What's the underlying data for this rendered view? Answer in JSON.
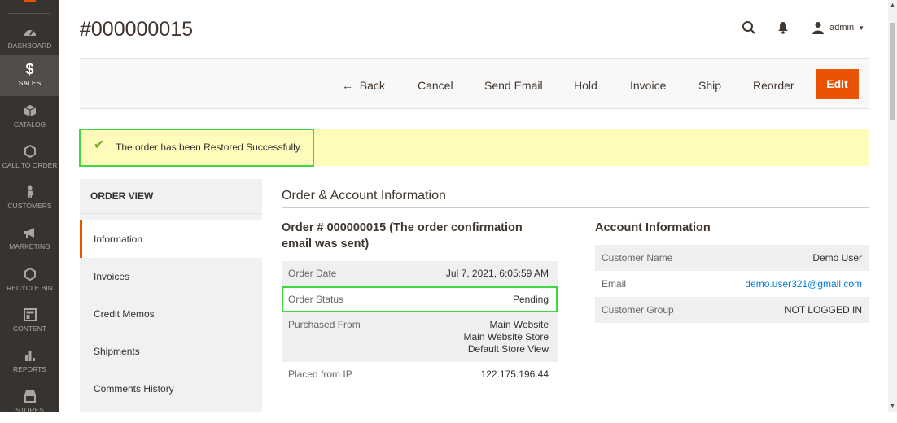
{
  "sidebar": {
    "items": [
      {
        "label": "DASHBOARD",
        "icon": "speedometer-icon"
      },
      {
        "label": "SALES",
        "icon": "dollar-icon"
      },
      {
        "label": "CATALOG",
        "icon": "box-icon"
      },
      {
        "label": "CALL TO ORDER",
        "icon": "hexagon-icon"
      },
      {
        "label": "CUSTOMERS",
        "icon": "person-icon"
      },
      {
        "label": "MARKETING",
        "icon": "megaphone-icon"
      },
      {
        "label": "RECYCLE BIN",
        "icon": "hexagon-icon"
      },
      {
        "label": "CONTENT",
        "icon": "layout-icon"
      },
      {
        "label": "REPORTS",
        "icon": "bar-chart-icon"
      },
      {
        "label": "STORES",
        "icon": "store-icon"
      }
    ]
  },
  "header": {
    "title": "#000000015",
    "user": "admin"
  },
  "actions": {
    "back": "Back",
    "cancel": "Cancel",
    "send_email": "Send Email",
    "hold": "Hold",
    "invoice": "Invoice",
    "ship": "Ship",
    "reorder": "Reorder",
    "edit": "Edit"
  },
  "message": "The order has been Restored Successfully.",
  "order_view": {
    "title": "ORDER VIEW",
    "tabs": [
      "Information",
      "Invoices",
      "Credit Memos",
      "Shipments",
      "Comments History"
    ]
  },
  "section_title": "Order & Account Information",
  "order": {
    "title_line1": "Order # 000000015 (The order confirmation",
    "title_line2": "email was sent)",
    "rows": [
      {
        "label": "Order Date",
        "value": "Jul 7, 2021, 6:05:59 AM"
      },
      {
        "label": "Order Status",
        "value": "Pending"
      },
      {
        "label": "Purchased From",
        "value_lines": [
          "Main Website",
          "Main Website Store",
          "Default Store View"
        ]
      },
      {
        "label": "Placed from IP",
        "value": "122.175.196.44"
      }
    ]
  },
  "account": {
    "title": "Account Information",
    "rows": [
      {
        "label": "Customer Name",
        "value": "Demo User"
      },
      {
        "label": "Email",
        "value": "demo.user321@gmail.com"
      },
      {
        "label": "Customer Group",
        "value": "NOT LOGGED IN"
      }
    ]
  },
  "colors": {
    "accent": "#eb5202",
    "sidebar": "#373330",
    "highlight": "#3fd93f",
    "message_bg": "#fffbbb",
    "link": "#007bdb"
  }
}
